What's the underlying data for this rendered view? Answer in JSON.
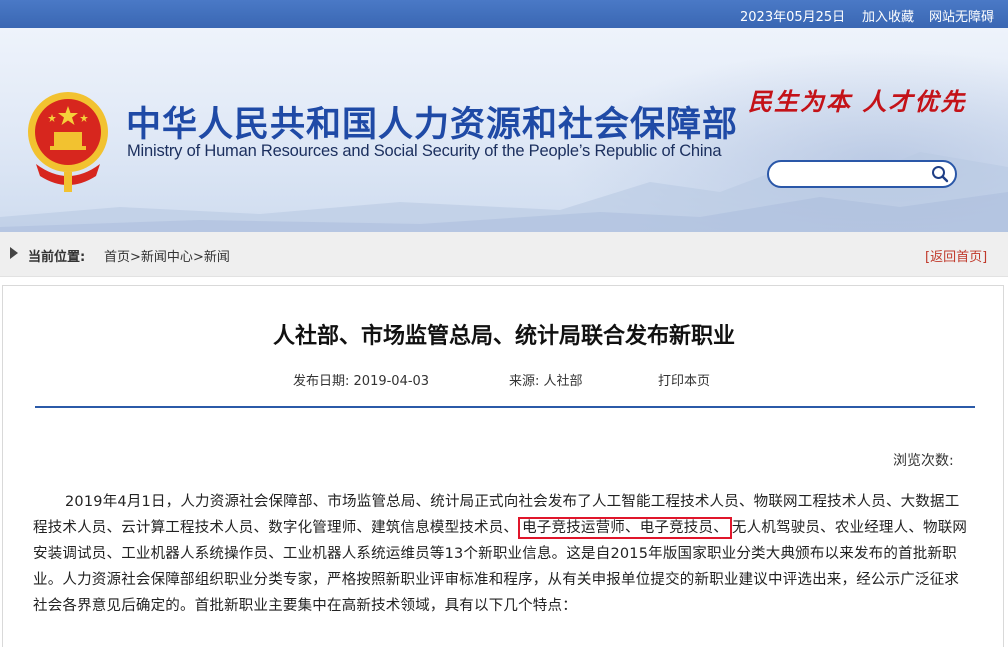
{
  "topbar": {
    "date": "2023年05月25日",
    "favorite": "加入收藏",
    "accessibility": "网站无障碍"
  },
  "header": {
    "title_cn": "中华人民共和国人力资源和社会保障部",
    "title_en": "Ministry of Human Resources and Social Security of the People’s Republic of China",
    "slogan": "民生为本  人才优先",
    "search": {
      "placeholder": "",
      "value": ""
    }
  },
  "breadcrumb": {
    "label": "当前位置:",
    "items": [
      "首页",
      "新闻中心",
      "新闻"
    ],
    "sep": ">",
    "back": "[返回首页]"
  },
  "article": {
    "title": "人社部、市场监管总局、统计局联合发布新职业",
    "date_label": "发布日期:",
    "date": "2019-04-03",
    "source_label": "来源:",
    "source": "人社部",
    "print": "打印本页",
    "views_label": "浏览次数:",
    "text_before": "2019年4月1日，人力资源社会保障部、市场监管总局、统计局正式向社会发布了人工智能工程技术人员、物联网工程技术人员、大数据工程技术人员、云计算工程技术人员、数字化管理师、建筑信息模型技术员、",
    "highlight": "电子竞技运营师、电子竞技员、",
    "text_after": "无人机驾驶员、农业经理人、物联网安装调试员、工业机器人系统操作员、工业机器人系统运维员等13个新职业信息。这是自2015年版国家职业分类大典颁布以来发布的首批新职业。人力资源社会保障部组织职业分类专家，严格按照新职业评审标准和程序，从有关申报单位提交的新职业建议中评选出来，经公示广泛征求社会各界意见后确定的。首批新职业主要集中在高新技术领域，具有以下几个特点："
  },
  "colors": {
    "brand_blue": "#1f4aa6",
    "slogan_red": "#c41218",
    "highlight_red": "#e0162b",
    "rule_blue": "#2b5aa8"
  },
  "icons": {
    "search": "search-icon",
    "emblem": "national-emblem-icon",
    "arrow": "triangle-right-icon"
  }
}
